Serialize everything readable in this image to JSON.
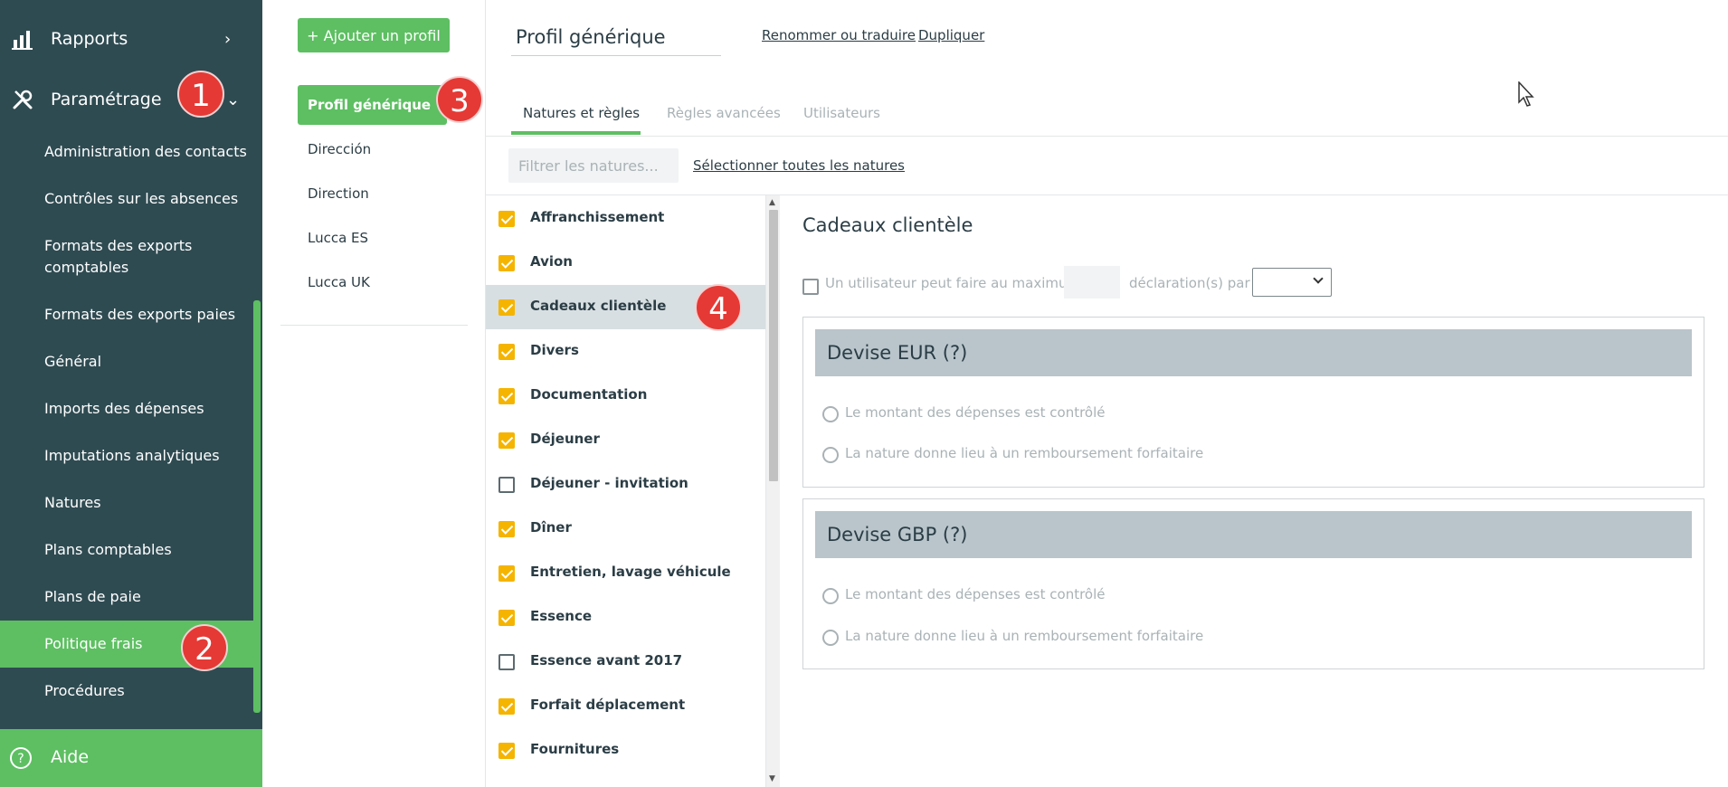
{
  "sidebar": {
    "rapports": "Rapports",
    "parametrage": "Paramétrage",
    "items": [
      {
        "label": "Administration des contacts"
      },
      {
        "label": "Contrôles sur les absences"
      },
      {
        "label": "Formats des exports comptables"
      },
      {
        "label": "Formats des exports paies"
      },
      {
        "label": "Général"
      },
      {
        "label": "Imports des dépenses"
      },
      {
        "label": "Imputations analytiques"
      },
      {
        "label": "Natures"
      },
      {
        "label": "Plans comptables"
      },
      {
        "label": "Plans de paie"
      },
      {
        "label": "Politique frais",
        "active": true
      },
      {
        "label": "Procédures"
      }
    ],
    "aide": "Aide"
  },
  "badges": {
    "b1": "1",
    "b2": "2",
    "b3": "3",
    "b4": "4"
  },
  "profiles": {
    "add_button": "+ Ajouter un profil",
    "items": [
      {
        "label": "Profil générique",
        "active": true
      },
      {
        "label": "Dirección"
      },
      {
        "label": "Direction"
      },
      {
        "label": "Lucca ES"
      },
      {
        "label": "Lucca UK"
      }
    ]
  },
  "header": {
    "profile_name": "Profil générique",
    "rename_link": "Renommer ou traduire",
    "duplicate_link": "Dupliquer"
  },
  "tabs": [
    {
      "label": "Natures et règles",
      "active": true
    },
    {
      "label": "Règles avancées"
    },
    {
      "label": "Utilisateurs"
    }
  ],
  "filter": {
    "placeholder": "Filtrer les natures...",
    "select_all": "Sélectionner toutes les natures"
  },
  "natures": [
    {
      "label": "Affranchissement",
      "checked": true
    },
    {
      "label": "Avion",
      "checked": true
    },
    {
      "label": "Cadeaux clientèle",
      "checked": true,
      "selected": true
    },
    {
      "label": "Divers",
      "checked": true
    },
    {
      "label": "Documentation",
      "checked": true
    },
    {
      "label": "Déjeuner",
      "checked": true
    },
    {
      "label": "Déjeuner - invitation",
      "checked": false
    },
    {
      "label": "Dîner",
      "checked": true
    },
    {
      "label": "Entretien, lavage véhicule",
      "checked": true
    },
    {
      "label": "Essence",
      "checked": true
    },
    {
      "label": "Essence avant 2017",
      "checked": false
    },
    {
      "label": "Forfait déplacement",
      "checked": true
    },
    {
      "label": "Fournitures",
      "checked": true
    }
  ],
  "detail": {
    "title": "Cadeaux clientèle",
    "max_prefix": "Un utilisateur peut faire au maximum",
    "max_suffix": "déclaration(s) par",
    "devises": [
      {
        "title": "Devise EUR (?)",
        "option1": "Le montant des dépenses est contrôlé",
        "option2": "La nature donne lieu à un remboursement forfaitaire"
      },
      {
        "title": "Devise GBP (?)",
        "option1": "Le montant des dépenses est contrôlé",
        "option2": "La nature donne lieu à un remboursement forfaitaire"
      }
    ]
  },
  "colors": {
    "accent": "#5dbf62",
    "sidebar": "#2f4b52",
    "checkbox": "#f5b400",
    "badge": "#e53935"
  }
}
